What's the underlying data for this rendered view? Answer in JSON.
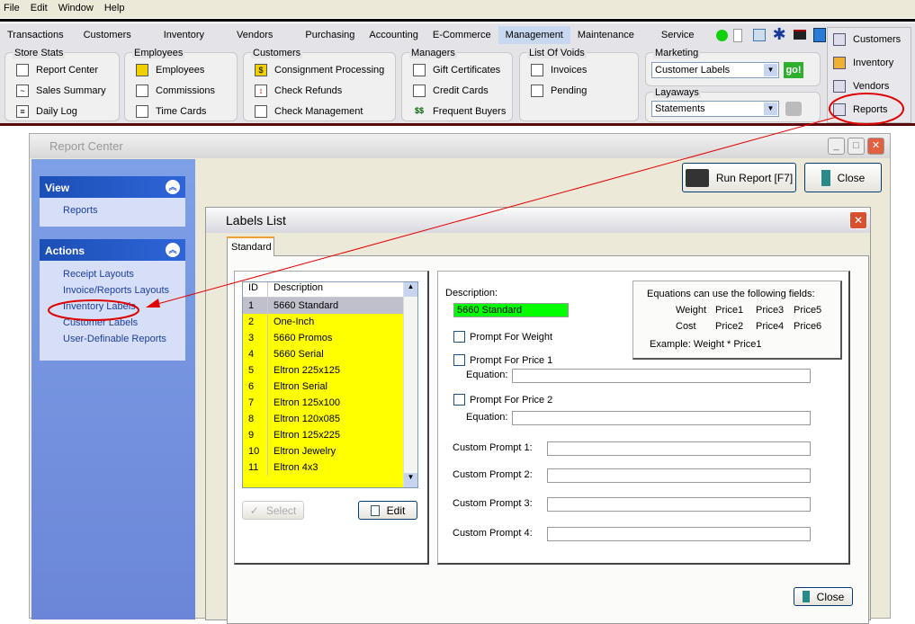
{
  "menu": [
    "File",
    "Edit",
    "Window",
    "Help"
  ],
  "tabs": [
    "Transactions",
    "Customers",
    "Inventory",
    "Vendors",
    "Purchasing",
    "Accounting",
    "E-Commerce",
    "Management",
    "Maintenance",
    "Service"
  ],
  "active_tab": "Management",
  "groups": {
    "store_stats": {
      "title": "Store Stats",
      "items": [
        "Report Center",
        "Sales Summary",
        "Daily Log"
      ]
    },
    "employees": {
      "title": "Employees",
      "items": [
        "Employees",
        "Commissions",
        "Time Cards"
      ]
    },
    "customers": {
      "title": "Customers",
      "items": [
        "Consignment Processing",
        "Check Refunds",
        "Check Management"
      ]
    },
    "managers": {
      "title": "Managers",
      "items": [
        "Gift Certificates",
        "Credit Cards",
        "Frequent Buyers"
      ]
    },
    "voids": {
      "title": "List Of Voids",
      "items": [
        "Invoices",
        "Pending"
      ]
    },
    "marketing": {
      "title": "Marketing",
      "select": "Customer Labels",
      "go": "go!"
    },
    "layaways": {
      "title": "Layaways",
      "select": "Statements"
    }
  },
  "right_nav": [
    "Customers",
    "Inventory",
    "Vendors",
    "Reports"
  ],
  "report_center": {
    "title": "Report Center",
    "view": {
      "title": "View",
      "items": [
        "Reports"
      ]
    },
    "actions": {
      "title": "Actions",
      "items": [
        "Receipt Layouts",
        "Invoice/Reports Layouts",
        "Inventory Labels",
        "Customer Labels",
        "User-Definable Reports"
      ]
    },
    "run_report": "Run Report [F7]",
    "close": "Close"
  },
  "labels_list": {
    "title": "Labels List",
    "tab": "Standard",
    "columns": [
      "ID",
      "Description"
    ],
    "rows": [
      [
        "1",
        "5660 Standard"
      ],
      [
        "2",
        "One-Inch"
      ],
      [
        "3",
        "5660 Promos"
      ],
      [
        "4",
        "5660 Serial"
      ],
      [
        "5",
        "Eltron 225x125"
      ],
      [
        "6",
        "Eltron Serial"
      ],
      [
        "7",
        "Eltron 125x100"
      ],
      [
        "8",
        "Eltron 120x085"
      ],
      [
        "9",
        "Eltron 125x225"
      ],
      [
        "10",
        "Eltron Jewelry"
      ],
      [
        "11",
        "Eltron 4x3"
      ]
    ],
    "select": "Select",
    "edit": "Edit",
    "description_label": "Description:",
    "description_value": "5660 Standard",
    "prompt_weight": "Prompt For Weight",
    "prompt_price1": "Prompt For Price 1",
    "prompt_price2": "Prompt For Price 2",
    "equation": "Equation:",
    "custom_prompts": [
      "Custom Prompt 1:",
      "Custom Prompt 2:",
      "Custom Prompt 3:",
      "Custom Prompt 4:"
    ],
    "eq_help": {
      "title": "Equations can use the following fields:",
      "fields": [
        [
          "Weight",
          "Price1",
          "Price3",
          "Price5"
        ],
        [
          "Cost",
          "Price2",
          "Price4",
          "Price6"
        ]
      ],
      "example": "Example: Weight * Price1"
    },
    "close": "Close"
  },
  "colors": {
    "highlight": "#ffff00",
    "desc_bg": "#00ff00",
    "annotation": "#e00000"
  }
}
